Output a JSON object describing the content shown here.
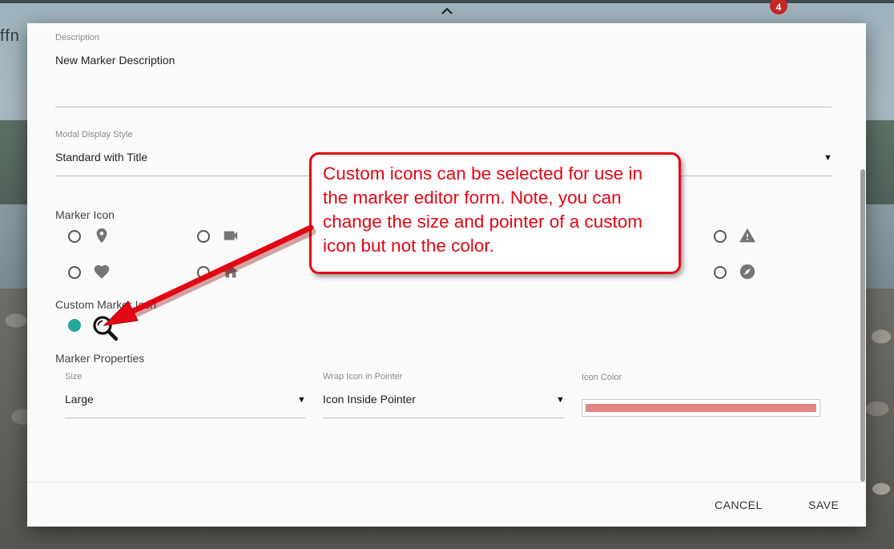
{
  "background": {
    "partial_text": "ffn",
    "collapse_icon": "chevron-up-icon",
    "notification_count": "4"
  },
  "modal": {
    "description": {
      "label": "Description",
      "value": "New Marker Description"
    },
    "display_style": {
      "label": "Modal Display Style",
      "value": "Standard with Title",
      "arrow": "▼"
    },
    "marker_icon": {
      "title": "Marker Icon",
      "options_visible": [
        {
          "icon": "map-pin-icon"
        },
        {
          "icon": "video-camera-icon"
        },
        {
          "icon": "warning-icon"
        },
        {
          "icon": "heart-icon"
        },
        {
          "icon": "home-icon"
        },
        {
          "icon": "compass-icon"
        }
      ]
    },
    "custom_marker_icon": {
      "title": "Custom Marker Icon",
      "selected": true,
      "icon": "magnifier-icon"
    },
    "marker_properties": {
      "title": "Marker Properties",
      "size": {
        "label": "Size",
        "value": "Large",
        "arrow": "▼"
      },
      "wrap": {
        "label": "Wrap Icon in Pointer",
        "value": "Icon Inside Pointer",
        "arrow": "▼"
      },
      "color": {
        "label": "Icon Color",
        "value": "#e58585"
      }
    },
    "footer": {
      "cancel": "CANCEL",
      "save": "SAVE"
    }
  },
  "callout": {
    "text": "Custom icons can be selected for use in the marker editor form. Note, you can change the size and pointer of a custom icon but not the color.",
    "color": "#e30613"
  },
  "colors": {
    "accent": "#26a69a",
    "badge": "#c62828"
  }
}
